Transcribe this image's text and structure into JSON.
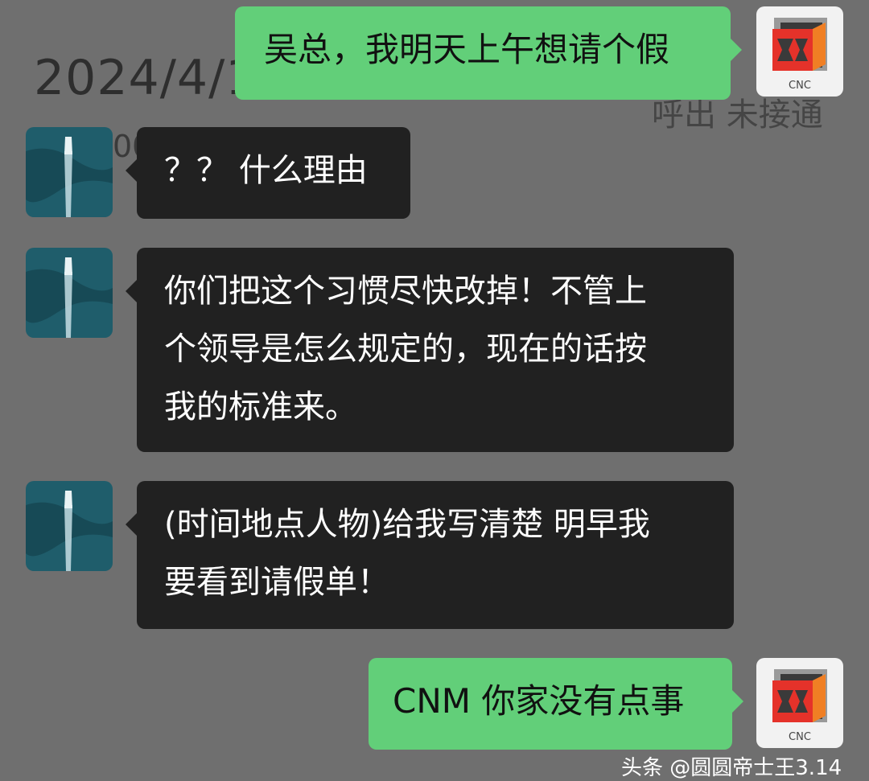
{
  "background": {
    "date_fragment": "2024/4/1",
    "call_status": "呼出 未接通",
    "partial_text": "00"
  },
  "self_avatar": {
    "logo_text": "CNC",
    "colors": {
      "cube_red": "#e5322a",
      "cube_orange": "#f07f24",
      "cube_gray": "#9a9a9a",
      "cube_dark": "#3a3a3a"
    }
  },
  "other_avatar": {
    "icon": "boat-aerial-icon",
    "colors": {
      "sea": "#1f5d6b",
      "sea_dark": "#123d48",
      "wake": "#cfe6ec"
    }
  },
  "messages": [
    {
      "from": "self",
      "text": "吴总，我明天上午想请个假"
    },
    {
      "from": "boss",
      "text": "？？ 什么理由"
    },
    {
      "from": "boss",
      "lines": [
        "你们把这个习惯尽快改掉！不管上",
        "个领导是怎么规定的，现在的话按",
        "我的标准来。"
      ]
    },
    {
      "from": "boss",
      "lines": [
        "(时间地点人物)给我写清楚 明早我",
        "要看到请假单！"
      ]
    },
    {
      "from": "self",
      "text": "CNM 你家没有点事"
    }
  ],
  "watermark": "头条 @圆圆帝士王3.14",
  "colors": {
    "background": "#6f6f6f",
    "bubble_self": "#62cf79",
    "bubble_other": "#212121",
    "text_on_dark": "#ffffff"
  }
}
